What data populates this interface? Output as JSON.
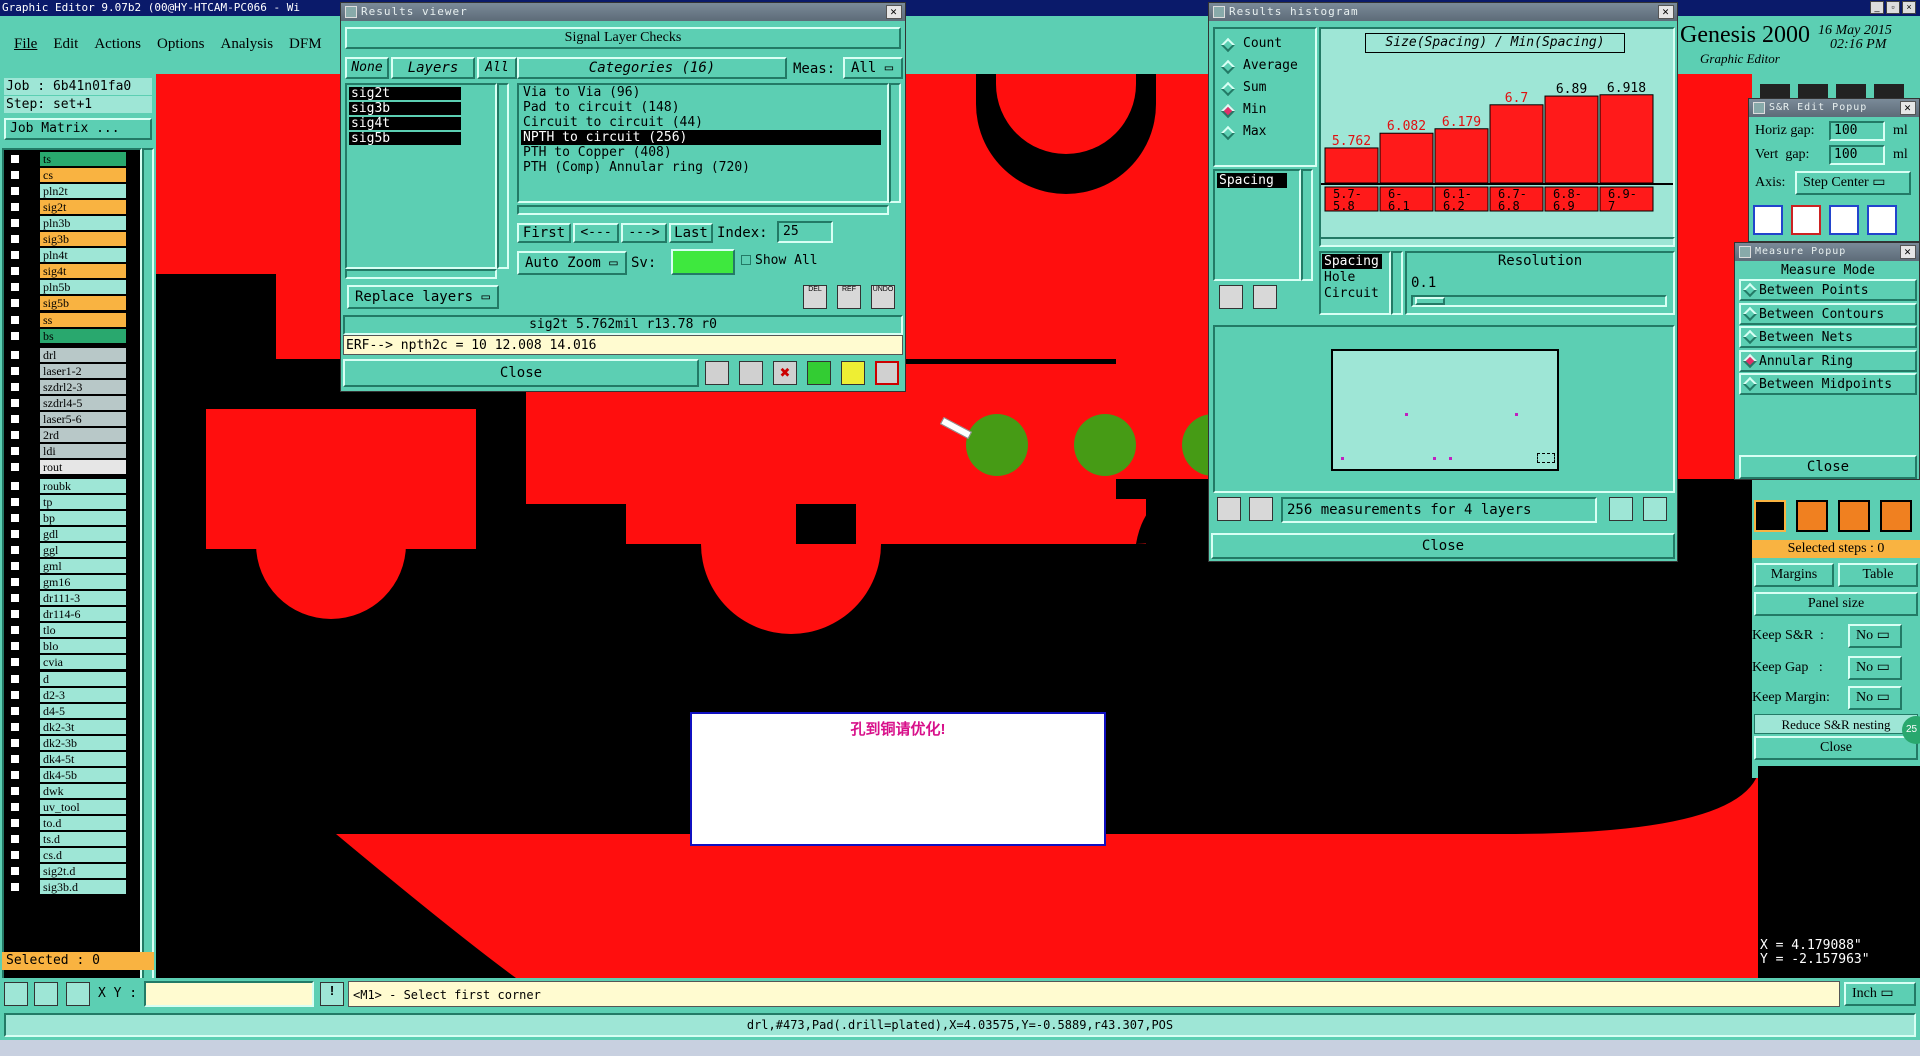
{
  "app": {
    "title": "Graphic Editor 9.07b2  (00@HY-HTCAM-PC066 - Wi",
    "brand": "Genesis 2000",
    "brand_sub": "Graphic Editor",
    "date": "16 May 2015",
    "time": "02:16 PM"
  },
  "menu": [
    "File",
    "Edit",
    "Actions",
    "Options",
    "Analysis",
    "DFM"
  ],
  "job": {
    "job": "Job : 6b41n01fa0",
    "step": "Step: set+1",
    "matrix_btn": "Job Matrix ..."
  },
  "layers": [
    {
      "name": "ts",
      "color": "#29a86e"
    },
    {
      "name": "cs",
      "color": "#f9b341"
    },
    {
      "name": "pln2t",
      "color": "#9ee6d6"
    },
    {
      "name": "sig2t",
      "color": "#f9b341"
    },
    {
      "name": "pln3b",
      "color": "#9ee6d6"
    },
    {
      "name": "sig3b",
      "color": "#f9b341"
    },
    {
      "name": "pln4t",
      "color": "#9ee6d6"
    },
    {
      "name": "sig4t",
      "color": "#f9b341"
    },
    {
      "name": "pln5b",
      "color": "#9ee6d6"
    },
    {
      "name": "sig5b",
      "color": "#f9b341"
    },
    {
      "name": "ss",
      "color": "#f9b341"
    },
    {
      "name": "bs",
      "color": "#29a86e"
    },
    {
      "name": "drl",
      "color": "#b8c8c8"
    },
    {
      "name": "laser1-2",
      "color": "#b8c8c8"
    },
    {
      "name": "szdrl2-3",
      "color": "#b8c8c8"
    },
    {
      "name": "szdrl4-5",
      "color": "#b8c8c8"
    },
    {
      "name": "laser5-6",
      "color": "#b8c8c8"
    },
    {
      "name": "2rd",
      "color": "#b8c8c8"
    },
    {
      "name": "ldi",
      "color": "#b8c8c8"
    },
    {
      "name": "rout",
      "color": "#e6e6e6"
    },
    {
      "name": "roubk",
      "color": "#9ee6d6"
    },
    {
      "name": "tp",
      "color": "#9ee6d6"
    },
    {
      "name": "bp",
      "color": "#9ee6d6"
    },
    {
      "name": "gdl",
      "color": "#9ee6d6"
    },
    {
      "name": "ggl",
      "color": "#9ee6d6"
    },
    {
      "name": "gml",
      "color": "#9ee6d6"
    },
    {
      "name": "gm16",
      "color": "#9ee6d6"
    },
    {
      "name": "dr111-3",
      "color": "#9ee6d6"
    },
    {
      "name": "dr114-6",
      "color": "#9ee6d6"
    },
    {
      "name": "tlo",
      "color": "#9ee6d6"
    },
    {
      "name": "blo",
      "color": "#9ee6d6"
    },
    {
      "name": "cvia",
      "color": "#9ee6d6"
    },
    {
      "name": "d",
      "color": "#9ee6d6"
    },
    {
      "name": "d2-3",
      "color": "#9ee6d6"
    },
    {
      "name": "d4-5",
      "color": "#9ee6d6"
    },
    {
      "name": "dk2-3t",
      "color": "#9ee6d6"
    },
    {
      "name": "dk2-3b",
      "color": "#9ee6d6"
    },
    {
      "name": "dk4-5t",
      "color": "#9ee6d6"
    },
    {
      "name": "dk4-5b",
      "color": "#9ee6d6"
    },
    {
      "name": "dwk",
      "color": "#9ee6d6"
    },
    {
      "name": "uv_tool",
      "color": "#9ee6d6"
    },
    {
      "name": "to.d",
      "color": "#9ee6d6"
    },
    {
      "name": "ts.d",
      "color": "#9ee6d6"
    },
    {
      "name": "cs.d",
      "color": "#9ee6d6"
    },
    {
      "name": "sig2t.d",
      "color": "#9ee6d6"
    },
    {
      "name": "sig3b.d",
      "color": "#9ee6d6"
    }
  ],
  "selected": "Selected : 0",
  "results_viewer": {
    "title": "Results viewer",
    "header": "Signal Layer Checks",
    "none": "None",
    "layers": "Layers",
    "all": "All",
    "categories": "Categories (16)",
    "meas": "Meas:",
    "meas_val": "All",
    "layer_list": [
      "sig2t",
      "sig3b",
      "sig4t",
      "sig5b"
    ],
    "cat_list": [
      "Via to Via (96)",
      "Pad to circuit (148)",
      "Circuit to circuit (44)",
      "NPTH to circuit (256)",
      "PTH to Copper (408)",
      "PTH (Comp) Annular ring (720)"
    ],
    "first": "First",
    "prev": "<---",
    "next": "--->",
    "last": "Last",
    "index_label": "Index:",
    "index_val": "25",
    "auto_zoom": "Auto Zoom",
    "sv": "Sv:",
    "show_all": "Show All",
    "replace": "Replace layers",
    "status": "sig2t 5.762mil   r13.78   r0",
    "erf": "ERF--> npth2c = 10 12.008 14.016",
    "close": "Close",
    "del": "DEL",
    "ref": "REF",
    "undo": "UNDO"
  },
  "histogram": {
    "title": "Results histogram",
    "chart_title": "Size(Spacing) / Min(Spacing)",
    "modes": [
      "Count",
      "Average",
      "Sum",
      "Min",
      "Max"
    ],
    "selected_mode": "Min",
    "type_list": [
      "Spacing"
    ],
    "type_list2": [
      "Spacing",
      "Hole",
      "Circuit"
    ],
    "resolution": "Resolution",
    "res_val": "0.1",
    "summary": "256 measurements for 4 layers",
    "close": "Close"
  },
  "chart_data": {
    "type": "bar",
    "title": "Size(Spacing) / Min(Spacing)",
    "categories": [
      "5.7-5.8",
      "6-6.1",
      "6.1-6.2",
      "6.7-6.8",
      "6.8-6.9",
      "6.9-7"
    ],
    "values": [
      5.762,
      6.082,
      6.179,
      6.7,
      6.89,
      6.918
    ],
    "value_labels": [
      "5.762",
      "6.082",
      "6.179",
      "6.7",
      "6.89",
      "6.918"
    ],
    "label_colors": [
      "#e01010",
      "#e01010",
      "#e01010",
      "#e01010",
      "#000000",
      "#000000"
    ],
    "bar_color": "#ff1a1a"
  },
  "sr_popup": {
    "title": "S&R Edit Popup",
    "horiz": "Horiz gap:",
    "horiz_val": "100",
    "vert": "Vert  gap:",
    "vert_val": "100",
    "unit": "ml",
    "axis": "Axis:",
    "axis_val": "Step Center"
  },
  "measure_popup": {
    "title": "Measure Popup",
    "mode": "Measure Mode",
    "items": [
      "Between Points",
      "Between Contours",
      "Between Nets",
      "Annular Ring",
      "Between Midpoints"
    ],
    "selected": "Annular Ring",
    "close": "Close"
  },
  "right_panel": {
    "selected_steps": "Selected steps : 0",
    "margins": "Margins",
    "table": "Table",
    "panel_size": "Panel size",
    "keep_sr": "Keep S&R  :",
    "keep_gap": "Keep Gap   :",
    "keep_margin": "Keep Margin:",
    "no": "No",
    "reduce": "Reduce S&R nesting",
    "close": "Close",
    "badge": "25"
  },
  "canvas": {
    "message": "孔到铜请优化!",
    "x_readout": "X = 4.179088\"",
    "y_readout": "Y = -2.157963\""
  },
  "bottom": {
    "xy": "X Y :",
    "prompt": "<M1> - Select first corner",
    "unit": "Inch",
    "status": "drl,#473,Pad(.drill=plated),X=4.03575,Y=-0.5889,r43.307,POS"
  }
}
